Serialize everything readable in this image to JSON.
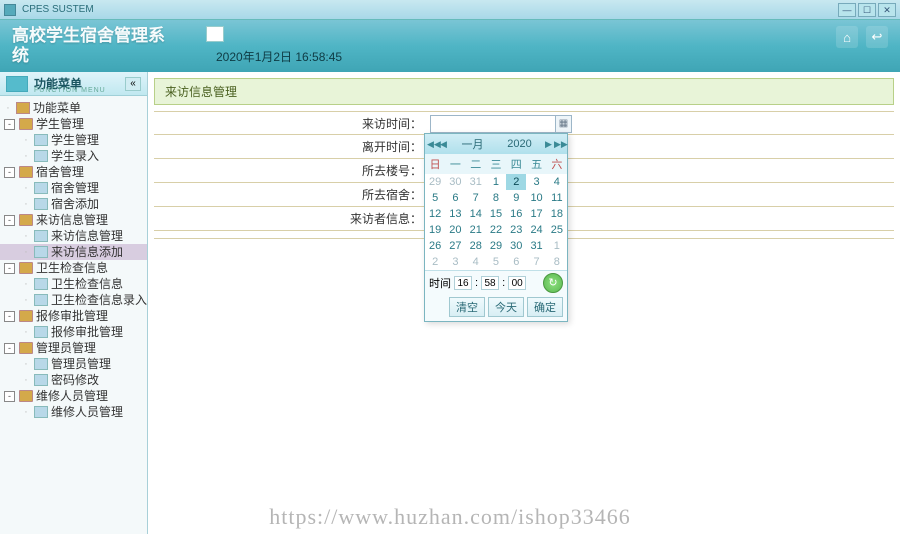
{
  "window": {
    "title": "CPES SUSTEM"
  },
  "header": {
    "system_title": "高校学生宿舍管理系统",
    "timestamp": "2020年1月2日 16:58:45"
  },
  "sidebar": {
    "title": "功能菜单",
    "subtitle": "FUNCTION MENU",
    "root": "功能菜单",
    "groups": [
      {
        "label": "学生管理",
        "children": [
          "学生管理",
          "学生录入"
        ]
      },
      {
        "label": "宿舍管理",
        "children": [
          "宿舍管理",
          "宿舍添加"
        ]
      },
      {
        "label": "来访信息管理",
        "children": [
          "来访信息管理",
          "来访信息添加"
        ]
      },
      {
        "label": "卫生检查信息",
        "children": [
          "卫生检查信息",
          "卫生检查信息录入"
        ]
      },
      {
        "label": "报修审批管理",
        "children": [
          "报修审批管理"
        ]
      },
      {
        "label": "管理员管理",
        "children": [
          "管理员管理",
          "密码修改"
        ]
      },
      {
        "label": "维修人员管理",
        "children": [
          "维修人员管理"
        ]
      }
    ],
    "selected_leaf": "来访信息添加"
  },
  "panel": {
    "title": "来访信息管理"
  },
  "form": {
    "fields": [
      {
        "label": "来访时间：",
        "name": "visit-time",
        "has_picker": true
      },
      {
        "label": "离开时间：",
        "name": "leave-time"
      },
      {
        "label": "所去楼号：",
        "name": "building-no"
      },
      {
        "label": "所去宿舍：",
        "name": "dorm-no"
      },
      {
        "label": "来访者信息：",
        "name": "visitor-info"
      }
    ]
  },
  "datepicker": {
    "month": "一月",
    "year": "2020",
    "weekdays": [
      "日",
      "一",
      "二",
      "三",
      "四",
      "五",
      "六"
    ],
    "weeks": [
      [
        {
          "d": 29,
          "o": 1
        },
        {
          "d": 30,
          "o": 1
        },
        {
          "d": 31,
          "o": 1
        },
        {
          "d": 1
        },
        {
          "d": 2,
          "sel": 1
        },
        {
          "d": 3
        },
        {
          "d": 4
        }
      ],
      [
        {
          "d": 5
        },
        {
          "d": 6
        },
        {
          "d": 7
        },
        {
          "d": 8
        },
        {
          "d": 9
        },
        {
          "d": 10
        },
        {
          "d": 11
        }
      ],
      [
        {
          "d": 12
        },
        {
          "d": 13
        },
        {
          "d": 14
        },
        {
          "d": 15
        },
        {
          "d": 16
        },
        {
          "d": 17
        },
        {
          "d": 18
        }
      ],
      [
        {
          "d": 19
        },
        {
          "d": 20
        },
        {
          "d": 21
        },
        {
          "d": 22
        },
        {
          "d": 23
        },
        {
          "d": 24
        },
        {
          "d": 25
        }
      ],
      [
        {
          "d": 26
        },
        {
          "d": 27
        },
        {
          "d": 28
        },
        {
          "d": 29
        },
        {
          "d": 30
        },
        {
          "d": 31
        },
        {
          "d": 1,
          "o": 1
        }
      ],
      [
        {
          "d": 2,
          "o": 1
        },
        {
          "d": 3,
          "o": 1
        },
        {
          "d": 4,
          "o": 1
        },
        {
          "d": 5,
          "o": 1
        },
        {
          "d": 6,
          "o": 1
        },
        {
          "d": 7,
          "o": 1
        },
        {
          "d": 8,
          "o": 1
        }
      ]
    ],
    "time_label": "时间",
    "h": "16",
    "m": "58",
    "s": "00",
    "buttons": {
      "clear": "清空",
      "today": "今天",
      "ok": "确定"
    }
  },
  "watermark": "https://www.huzhan.com/ishop33466"
}
